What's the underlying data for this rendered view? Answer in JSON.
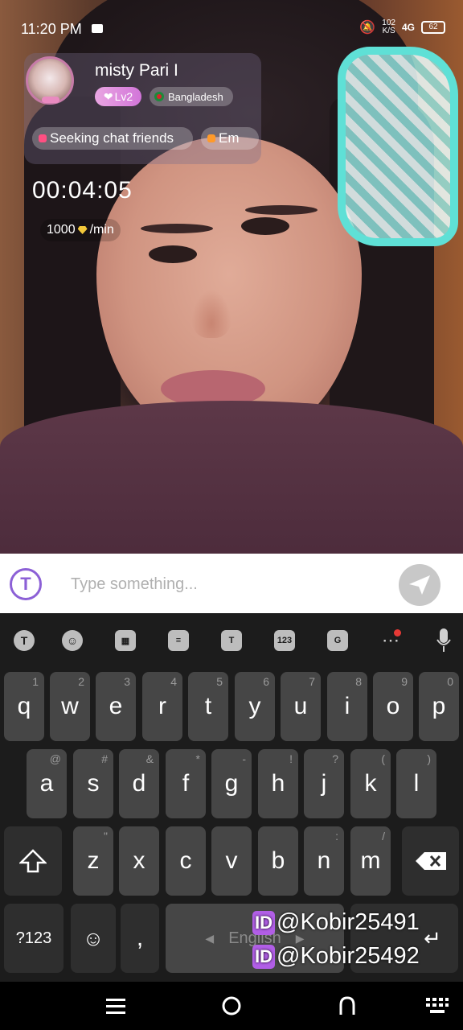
{
  "status_bar": {
    "time": "11:20 PM",
    "speed": "102",
    "speed_unit": "K/S",
    "network": "4G",
    "battery": "62"
  },
  "host": {
    "name": "misty  Pari I",
    "level": "Lv2",
    "country": "Bangladesh",
    "tags": [
      "Seeking chat friends",
      "Em"
    ]
  },
  "call": {
    "timer": "00:04:05",
    "rate_value": "1000",
    "rate_unit": "/min"
  },
  "input": {
    "placeholder": "Type something..."
  },
  "keyboard": {
    "toolbar": [
      "123"
    ],
    "row1": [
      {
        "key": "q",
        "hint": "1"
      },
      {
        "key": "w",
        "hint": "2"
      },
      {
        "key": "e",
        "hint": "3"
      },
      {
        "key": "r",
        "hint": "4"
      },
      {
        "key": "t",
        "hint": "5"
      },
      {
        "key": "y",
        "hint": "6"
      },
      {
        "key": "u",
        "hint": "7"
      },
      {
        "key": "i",
        "hint": "8"
      },
      {
        "key": "o",
        "hint": "9"
      },
      {
        "key": "p",
        "hint": "0"
      }
    ],
    "row2": [
      {
        "key": "a",
        "hint": "@"
      },
      {
        "key": "s",
        "hint": "#"
      },
      {
        "key": "d",
        "hint": "&"
      },
      {
        "key": "f",
        "hint": "*"
      },
      {
        "key": "g",
        "hint": "-"
      },
      {
        "key": "h",
        "hint": "!"
      },
      {
        "key": "j",
        "hint": "?"
      },
      {
        "key": "k",
        "hint": "("
      },
      {
        "key": "l",
        "hint": ")"
      }
    ],
    "row3": [
      {
        "key": "z",
        "hint": "\""
      },
      {
        "key": "x",
        "hint": ""
      },
      {
        "key": "c",
        "hint": ""
      },
      {
        "key": "v",
        "hint": ""
      },
      {
        "key": "b",
        "hint": ""
      },
      {
        "key": "n",
        "hint": ":"
      },
      {
        "key": "m",
        "hint": "/"
      }
    ],
    "symbols_key": "?123",
    "comma_key": ",",
    "space_label": "English"
  },
  "watermark": {
    "line1_badge": "ID",
    "line1_text": "@Kobir25491",
    "line2_badge": "ID",
    "line2_text": "@Kobir25492"
  }
}
